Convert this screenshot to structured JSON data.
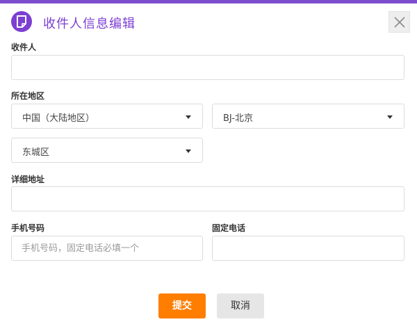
{
  "header": {
    "title": "收件人信息编辑",
    "logo_icon": "document-icon",
    "close_icon": "close-icon"
  },
  "form": {
    "recipient": {
      "label": "收件人",
      "value": "",
      "placeholder": ""
    },
    "region": {
      "label": "所在地区",
      "country": "中国（大陆地区）",
      "province": "BJ-北京",
      "district": "东城区"
    },
    "address": {
      "label": "详细地址",
      "value": "",
      "placeholder": ""
    },
    "mobile": {
      "label": "手机号码",
      "value": "",
      "placeholder": "手机号码，固定电话必填一个"
    },
    "landline": {
      "label": "固定电话",
      "value": "",
      "placeholder": ""
    }
  },
  "actions": {
    "submit_label": "提交",
    "cancel_label": "取消"
  },
  "colors": {
    "accent": "#7c3fd2",
    "primary_button": "#ff7e00",
    "secondary_button": "#e6e6e6"
  }
}
